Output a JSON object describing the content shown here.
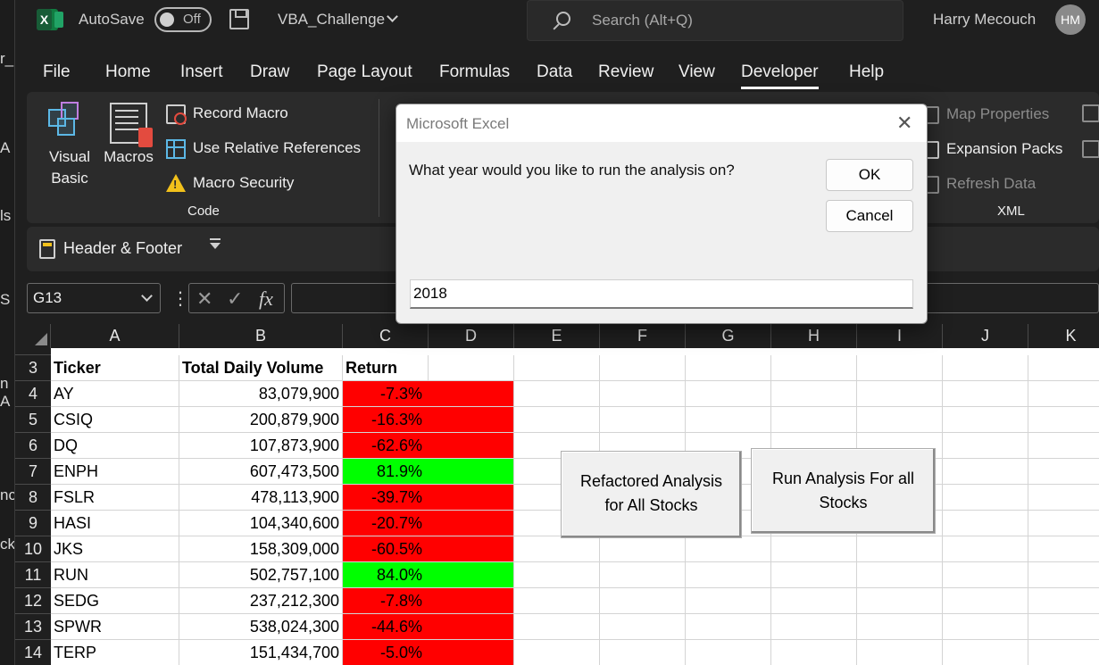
{
  "left_strip": {
    "fragments": [
      "r_",
      "A",
      "ls",
      "S",
      "n A",
      "nc",
      "ck"
    ]
  },
  "titlebar": {
    "autosave_label": "AutoSave",
    "autosave_state": "Off",
    "filename": "VBA_Challenge",
    "search_placeholder": "Search (Alt+Q)",
    "user_name": "Harry Mecouch",
    "user_initials": "HM",
    "app_icon_letter": "X"
  },
  "tabs": [
    "File",
    "Home",
    "Insert",
    "Draw",
    "Page Layout",
    "Formulas",
    "Data",
    "Review",
    "View",
    "Developer",
    "Help"
  ],
  "active_tab": "Developer",
  "ribbon": {
    "visual_basic": [
      "Visual",
      "Basic"
    ],
    "macros": "Macros",
    "record_macro": "Record Macro",
    "relative_refs": "Use Relative References",
    "macro_security": "Macro Security",
    "code_group": "Code",
    "map_properties": "Map Properties",
    "expansion_packs": "Expansion Packs",
    "refresh_data": "Refresh Data",
    "xml_group": "XML",
    "header_footer": "Header & Footer"
  },
  "formula_bar": {
    "name_box": "G13",
    "fx": "fx",
    "cancel": "✕",
    "enter": "✓",
    "dots": "⋮",
    "value": ""
  },
  "sheet": {
    "columns": [
      "A",
      "B",
      "C",
      "D",
      "E",
      "F",
      "G",
      "H",
      "I",
      "J",
      "K"
    ],
    "header_row": {
      "row": "3",
      "a": "Ticker",
      "b": "Total Daily Volume",
      "c": "Return"
    },
    "rows": [
      {
        "row": "4",
        "ticker": "AY",
        "volume": "83,079,900",
        "ret": "-7.3%",
        "positive": false
      },
      {
        "row": "5",
        "ticker": "CSIQ",
        "volume": "200,879,900",
        "ret": "-16.3%",
        "positive": false
      },
      {
        "row": "6",
        "ticker": "DQ",
        "volume": "107,873,900",
        "ret": "-62.6%",
        "positive": false
      },
      {
        "row": "7",
        "ticker": "ENPH",
        "volume": "607,473,500",
        "ret": "81.9%",
        "positive": true
      },
      {
        "row": "8",
        "ticker": "FSLR",
        "volume": "478,113,900",
        "ret": "-39.7%",
        "positive": false
      },
      {
        "row": "9",
        "ticker": "HASI",
        "volume": "104,340,600",
        "ret": "-20.7%",
        "positive": false
      },
      {
        "row": "10",
        "ticker": "JKS",
        "volume": "158,309,000",
        "ret": "-60.5%",
        "positive": false
      },
      {
        "row": "11",
        "ticker": "RUN",
        "volume": "502,757,100",
        "ret": "84.0%",
        "positive": true
      },
      {
        "row": "12",
        "ticker": "SEDG",
        "volume": "237,212,300",
        "ret": "-7.8%",
        "positive": false
      },
      {
        "row": "13",
        "ticker": "SPWR",
        "volume": "538,024,300",
        "ret": "-44.6%",
        "positive": false
      },
      {
        "row": "14",
        "ticker": "TERP",
        "volume": "151,434,700",
        "ret": "-5.0%",
        "positive": false
      }
    ],
    "buttons": {
      "refactored": [
        "Refactored Analysis",
        "for All Stocks"
      ],
      "run_all": [
        "Run Analysis For all",
        "Stocks"
      ]
    }
  },
  "colors": {
    "negative_fill": "#ff0000",
    "positive_fill": "#00ff00",
    "excel_green": "#107c41"
  },
  "dialog": {
    "title": "Microsoft Excel",
    "close": "✕",
    "prompt": "What year would you like to run the analysis on?",
    "ok": "OK",
    "cancel": "Cancel",
    "input_value": "2018"
  }
}
